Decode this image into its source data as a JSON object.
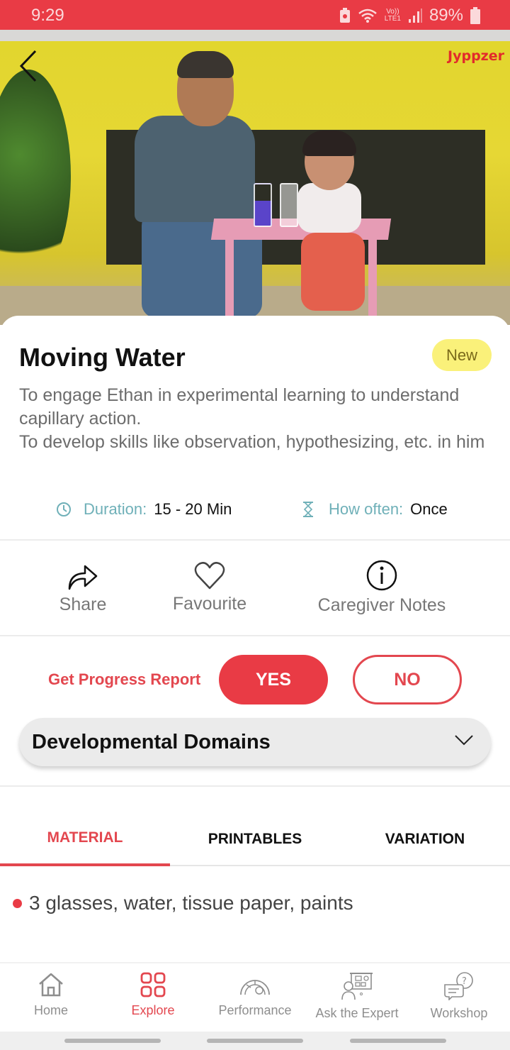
{
  "status_bar": {
    "time": "9:29",
    "network_top": "Vo))",
    "network_bottom": "LTE1",
    "battery": "89%"
  },
  "hero": {
    "brand": "Jyppzer"
  },
  "activity": {
    "title": "Moving Water",
    "badge": "New",
    "description_lines": [
      "To engage Ethan in experimental learning to understand capillary action.",
      "To develop skills like observation, hypothesizing, etc. in him"
    ],
    "duration_label": "Duration:",
    "duration_value": "15 - 20 Min",
    "frequency_label": "How often:",
    "frequency_value": "Once"
  },
  "actions": {
    "share": "Share",
    "favourite": "Favourite",
    "caregiver_notes": "Caregiver Notes"
  },
  "progress": {
    "label": "Get Progress Report",
    "yes": "YES",
    "no": "NO"
  },
  "domains": {
    "label": "Developmental Domains"
  },
  "tabs": [
    {
      "label": "MATERIAL",
      "active": true
    },
    {
      "label": "PRINTABLES",
      "active": false
    },
    {
      "label": "VARIATION",
      "active": false
    }
  ],
  "materials": [
    "3 glasses, water, tissue paper, paints"
  ],
  "colors": {
    "accent": "#e93b45",
    "teal_label": "#6fb0b8",
    "badge_bg": "#faf17a"
  },
  "bottom_nav": [
    {
      "label": "Home",
      "icon": "home-icon",
      "active": false
    },
    {
      "label": "Explore",
      "icon": "grid-icon",
      "active": true
    },
    {
      "label": "Performance",
      "icon": "gauge-icon",
      "active": false
    },
    {
      "label": "Ask the Expert",
      "icon": "expert-presenter-icon",
      "active": false
    },
    {
      "label": "Workshop",
      "icon": "chat-question-icon",
      "active": false
    }
  ]
}
